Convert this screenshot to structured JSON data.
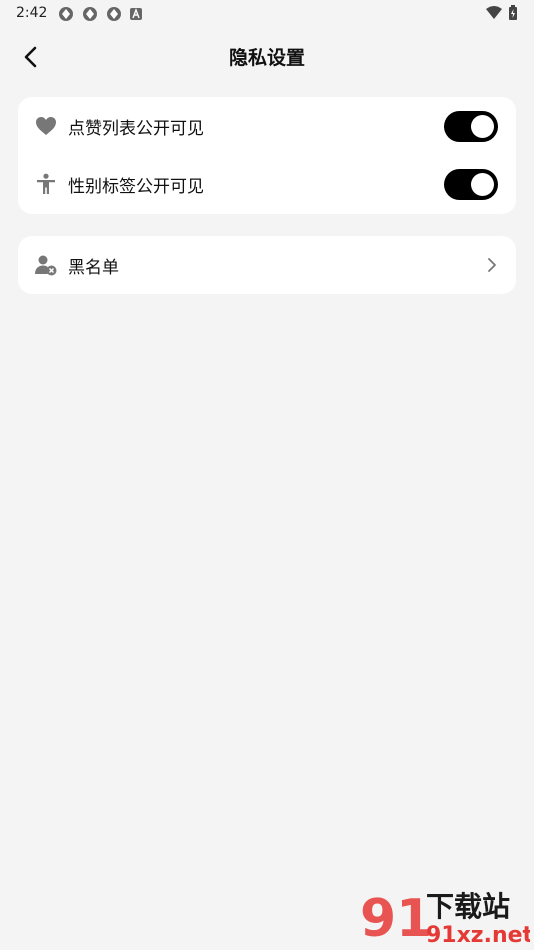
{
  "status_bar": {
    "time": "2:42"
  },
  "header": {
    "title": "隐私设置",
    "back_icon": "chevron-left-icon"
  },
  "privacy_card": {
    "items": [
      {
        "label": "点赞列表公开可见",
        "icon": "heart-icon",
        "enabled": true
      },
      {
        "label": "性别标签公开可见",
        "icon": "person-icon",
        "enabled": true
      }
    ]
  },
  "blacklist_card": {
    "label": "黑名单",
    "icon": "user-blocked-icon",
    "chevron": "chevron-right-icon"
  },
  "watermark": {
    "text_cn": "下载站",
    "text_en": "91xz.net",
    "logo": "91"
  },
  "colors": {
    "background": "#f4f4f4",
    "card": "#ffffff",
    "toggle_on": "#000000",
    "icon_gray": "#777777",
    "watermark_red": "#e53935"
  }
}
